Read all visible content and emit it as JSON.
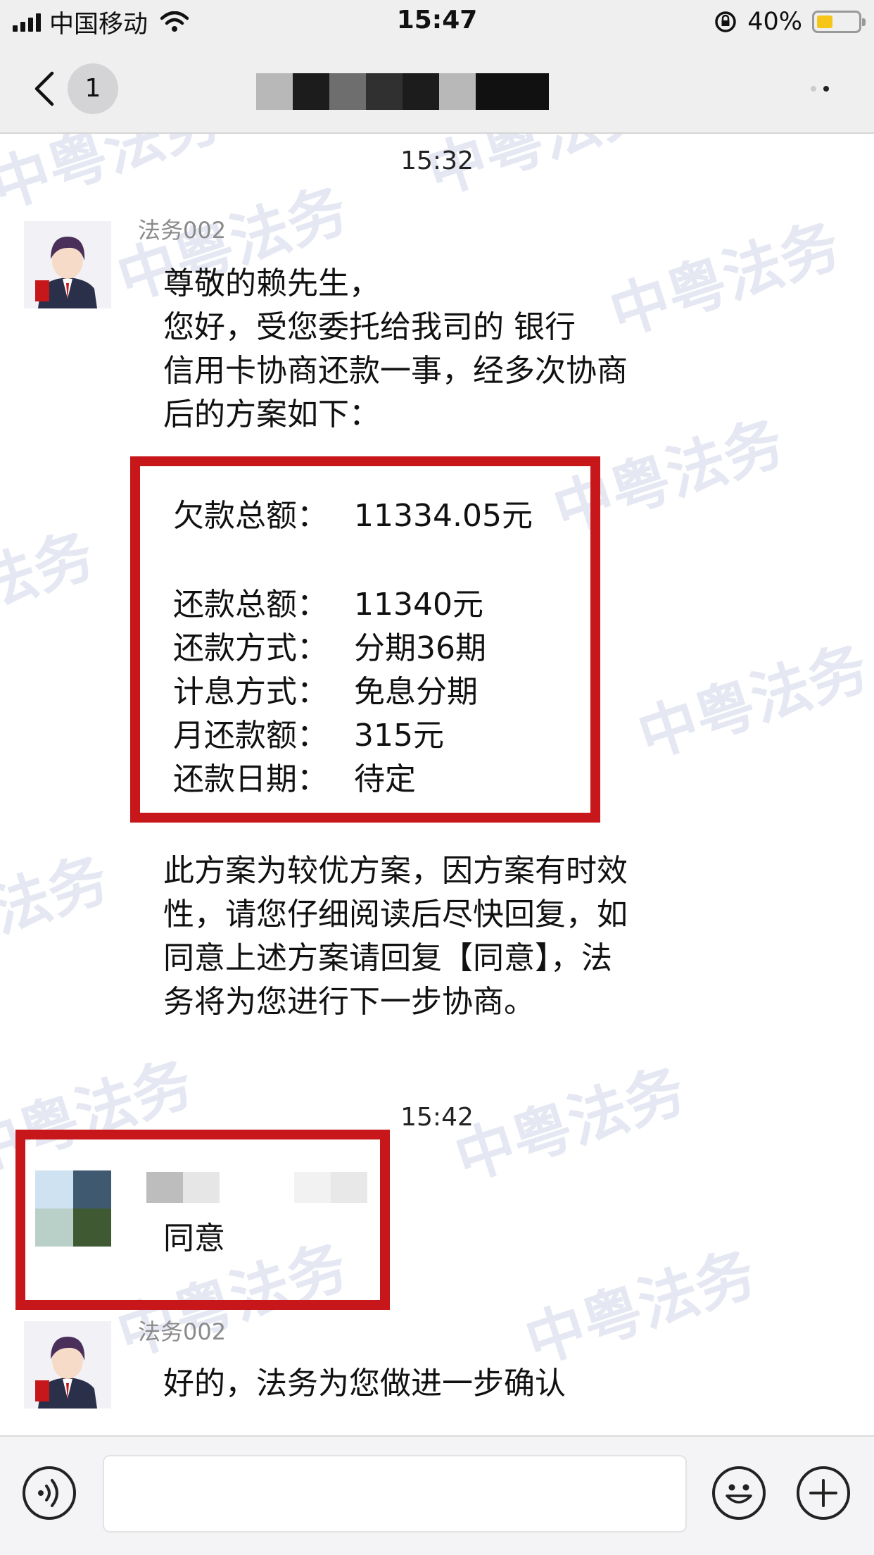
{
  "status_bar": {
    "carrier": "中国移动",
    "time": "15:47",
    "battery_pct": "40%",
    "battery_level": 0.4,
    "battery_color": "#f5c518"
  },
  "nav": {
    "back_icon": "chevron-left-icon",
    "unread_count": "1",
    "more_icon": "more-dots-icon"
  },
  "watermark_text": "中粤法务",
  "messages": [
    {
      "timestamp": "15:32",
      "sender": "法务002",
      "intro_lines": [
        "尊敬的赖先生，",
        "您好，受您委托给我司的   银行",
        "信用卡协商还款一事，经多次协商",
        "后的方案如下："
      ],
      "plan": {
        "debt_label": "欠款总额：",
        "debt_value": "11334.05元",
        "rows": [
          {
            "label": "还款总额：",
            "value": "11340元"
          },
          {
            "label": "还款方式：",
            "value": "分期36期"
          },
          {
            "label": "计息方式：",
            "value": "免息分期"
          },
          {
            "label": "月还款额：",
            "value": "315元"
          },
          {
            "label": "还款日期：",
            "value": "待定"
          }
        ]
      },
      "outro_lines": [
        "此方案为较优方案，因方案有时效",
        "性，请您仔细阅读后尽快回复，如",
        "同意上述方案请回复【同意】，法",
        "务将为您进行下一步协商。"
      ]
    },
    {
      "timestamp": "15:42",
      "text": "同意"
    },
    {
      "sender": "法务002",
      "text": "好的，法务为您做进一步确认"
    }
  ],
  "input_bar": {
    "voice_icon": "voice-icon",
    "emoji_icon": "emoji-icon",
    "plus_icon": "plus-icon",
    "placeholder": ""
  }
}
